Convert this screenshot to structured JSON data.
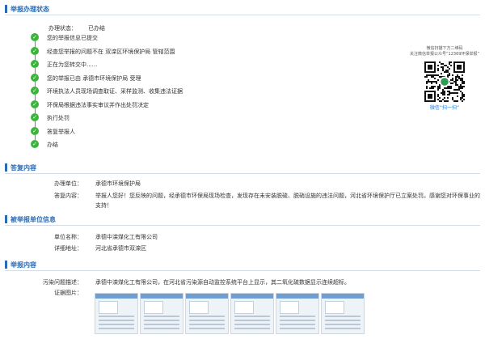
{
  "sections": {
    "status_title": "举报办理状态",
    "reply_title": "答复内容",
    "unit_title": "被举报单位信息",
    "content_title": "举报内容"
  },
  "status": {
    "label": "办理状态：",
    "value": "已办结"
  },
  "steps": [
    "您的举报信息已提交",
    "经查您举报的问题不在 双滦区环境保护局 管辖范围",
    "正在为您转交中......",
    "您的举报已由 承德市环境保护局 受理",
    "环境执法人员现场调查取证、采样监测、收集违法证据",
    "环保局根据违法事实审议并作出处罚决定",
    "执行处罚",
    "答复举报人",
    "办结"
  ],
  "qr": {
    "line1": "微信扫描下方二维码",
    "line2": "关注微信举报公众号“12369环保举报”",
    "caption": "微信“扫一扫”"
  },
  "reply": {
    "unit_label": "办理单位：",
    "unit_value": "承德市环境保护局",
    "content_label": "答复内容：",
    "content_value": "举报人您好！您反映的问题，经承德市环保局现场检查，发现存在未安装脱硫、脱硝设施的违法问题，河北省环境保护厅已立案处罚。感谢您对环保事业的支持！"
  },
  "unit": {
    "name_label": "单位名称：",
    "name_value": "承德中滦煤化工有限公司",
    "addr_label": "详细地址：",
    "addr_value": "河北省承德市双滦区"
  },
  "content": {
    "desc_label": "污染问题描述：",
    "desc_value": "承德中滦煤化工有限公司，在河北省污染源自动监控系统平台上显示，其二氧化硫数据显示连续超标。",
    "images_label": "证据图片："
  },
  "colors": {
    "accent": "#2a6ab3",
    "check": "#3cb43c",
    "link": "#1e7ad6"
  },
  "icons": {
    "step": "check-circle-icon",
    "qr": "qr-code-icon"
  }
}
